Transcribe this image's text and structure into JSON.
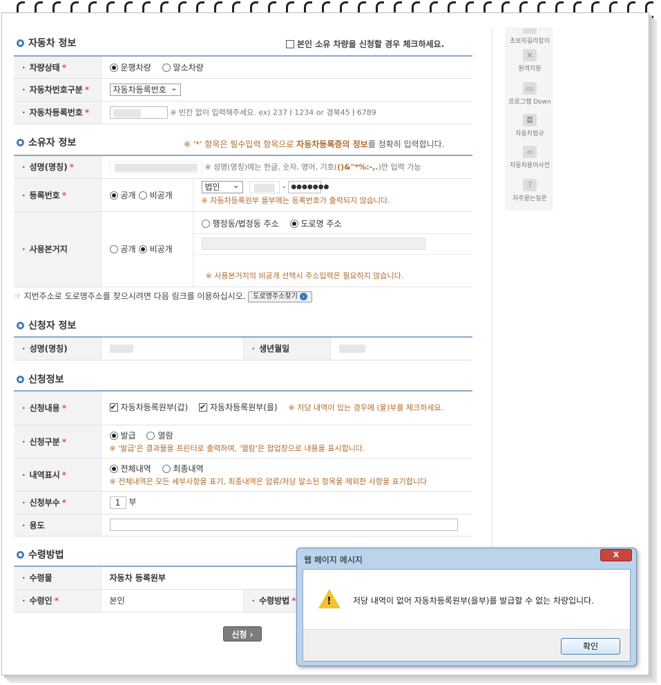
{
  "vehicle": {
    "title": "자동차 정보",
    "own_check_label": "본인 소유 차량을 신청할 경우 체크하세요.",
    "status_label": "차량상태",
    "status_opt1": "운행차량",
    "status_opt2": "말소차량",
    "numtype_label": "자동차번호구분",
    "numtype_value": "자동차등록번호",
    "regnum_label": "자동차등록번호",
    "regnum_hint": "※ 빈칸 없이 입력해주세요. ex) 237ㅏ1234 or 경북45ㅏ6789"
  },
  "owner": {
    "title": "소유자 정보",
    "notice_pre": "※ '*' 항목은 필수입력 항목으로 ",
    "notice_bold": "자동차등록증의 정보",
    "notice_post": "를 정확히 입력합니다.",
    "name_label": "성명(명칭)",
    "name_hint_pre": "※ 성명(명칭)에는 한글, 숫자, 영어, 기호(",
    "name_hint_sym": "()&\"*%:-,.",
    "name_hint_post": ")만 입력 가능",
    "reg_label": "등록번호",
    "reg_public": "공개",
    "reg_private": "비공개",
    "reg_select": "법인",
    "reg_dash": "-",
    "reg_masked": "●●●●●●●",
    "reg_note": "※ 자동차등록원부 을부에는 등록번호가 출력되지 않습니다.",
    "addr_label": "사용본거지",
    "addr_public": "공개",
    "addr_private": "비공개",
    "addr_opt1": "행정동/법정동 주소",
    "addr_opt2": "도로명 주소",
    "addr_note": "※ 사용본거지의 비공개 선택시 주소입력은 필요하지 않습니다.",
    "road_hint": "지번주소로 도로명주소를 찾으시려면 다음 링크를 이용하십시오.",
    "road_btn": "도로명주소찾기"
  },
  "applicant": {
    "title": "신청자 정보",
    "name_label": "성명(명칭)",
    "birth_label": "생년월일"
  },
  "application": {
    "title": "신청정보",
    "content_label": "신청내용",
    "content_opt1": "자동차등록원부(갑)",
    "content_opt2": "자동차등록원부(을)",
    "content_note": "※ 저당 내역이 있는 경우에 (을)부를 체크하세요.",
    "type_label": "신청구분",
    "type_opt1": "발급",
    "type_opt2": "열람",
    "type_note": "※ '발급'은 결과물을 프린터로 출력하며, '열람'은 팝업창으로 내용을 표시합니다.",
    "history_label": "내역표시",
    "history_opt1": "전체내역",
    "history_opt2": "최종내역",
    "history_note": "※ 전체내역은 모든 세부사항을 표기, 최종내역은 압류/저당 말소된 항목을 제외한 사항을 표기합니다",
    "copies_label": "신청부수",
    "copies_value": "1",
    "copies_unit": "부",
    "purpose_label": "용도"
  },
  "receipt": {
    "title": "수령방법",
    "item_label": "수령물",
    "item_value": "자동차 등록원부",
    "person_label": "수령인",
    "person_value": "본인",
    "method_label": "수령방법"
  },
  "apply_button": "신청 ›",
  "sidebar": [
    {
      "label": "초보자길라잡이"
    },
    {
      "label": "원격지원"
    },
    {
      "label": "프로그램 Down"
    },
    {
      "label": "자동차법규"
    },
    {
      "label": "자동차용어사전"
    },
    {
      "label": "자주묻는질문"
    }
  ],
  "dialog": {
    "title": "웹 페이지 메시지",
    "close": "X",
    "message": "저당 내역이 없어 자동차등록원부(을부)를 발급할 수 없는 차량입니다.",
    "ok": "확인"
  }
}
